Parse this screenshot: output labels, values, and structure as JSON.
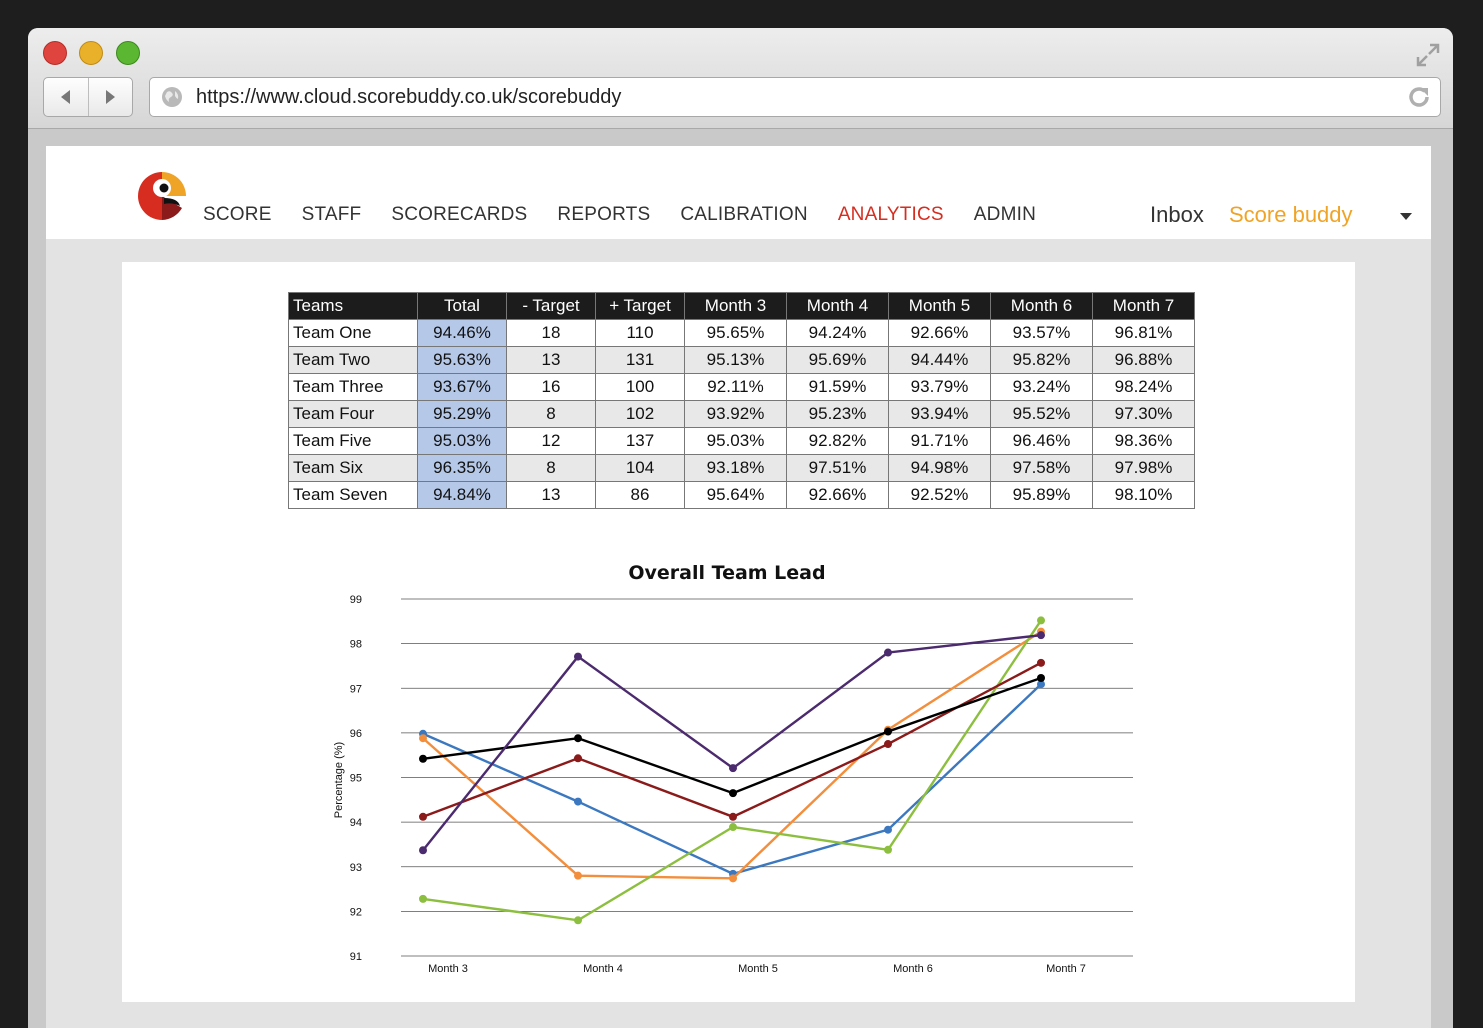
{
  "browser": {
    "url": "https://www.cloud.scorebuddy.co.uk/scorebuddy"
  },
  "nav": {
    "items": [
      {
        "label": "SCORE",
        "active": false
      },
      {
        "label": "STAFF",
        "active": false
      },
      {
        "label": "SCORECARDS",
        "active": false
      },
      {
        "label": "REPORTS",
        "active": false
      },
      {
        "label": "CALIBRATION",
        "active": false
      },
      {
        "label": "ANALYTICS",
        "active": true
      },
      {
        "label": "ADMIN",
        "active": false
      }
    ],
    "inbox": "Inbox",
    "user": "Score buddy",
    "active_color": "#d62d20",
    "user_color": "#f0a427"
  },
  "table": {
    "headers": [
      "Teams",
      "Total",
      "- Target",
      "+ Target",
      "Month 3",
      "Month 4",
      "Month 5",
      "Month 6",
      "Month 7"
    ],
    "rows": [
      [
        "Team One",
        "94.46%",
        "18",
        "110",
        "95.65%",
        "94.24%",
        "92.66%",
        "93.57%",
        "96.81%"
      ],
      [
        "Team Two",
        "95.63%",
        "13",
        "131",
        "95.13%",
        "95.69%",
        "94.44%",
        "95.82%",
        "96.88%"
      ],
      [
        "Team Three",
        "93.67%",
        "16",
        "100",
        "92.11%",
        "91.59%",
        "93.79%",
        "93.24%",
        "98.24%"
      ],
      [
        "Team Four",
        "95.29%",
        "8",
        "102",
        "93.92%",
        "95.23%",
        "93.94%",
        "95.52%",
        "97.30%"
      ],
      [
        "Team Five",
        "95.03%",
        "12",
        "137",
        "95.03%",
        "92.82%",
        "91.71%",
        "96.46%",
        "98.36%"
      ],
      [
        "Team Six",
        "96.35%",
        "8",
        "104",
        "93.18%",
        "97.51%",
        "94.98%",
        "97.58%",
        "97.98%"
      ],
      [
        "Team Seven",
        "94.84%",
        "13",
        "86",
        "95.64%",
        "92.66%",
        "92.52%",
        "95.89%",
        "98.10%"
      ]
    ],
    "total_highlight": "#b5c8e8"
  },
  "chart_data": {
    "type": "line",
    "title": "Overall Team Lead",
    "ylabel": "Percentage (%)",
    "xlabel": "",
    "categories": [
      "Month 3",
      "Month 4",
      "Month 5",
      "Month 6",
      "Month 7"
    ],
    "ylim": [
      91,
      99
    ],
    "yticks": [
      "91",
      "92",
      "93",
      "94",
      "95",
      "96",
      "97",
      "98",
      "99"
    ],
    "grid": true,
    "legend": "none",
    "series": [
      {
        "color": "#3b78c0",
        "values": [
          95.98,
          94.46,
          92.84,
          93.83,
          97.09
        ]
      },
      {
        "color": "#f28e3c",
        "values": [
          95.88,
          92.8,
          92.74,
          96.07,
          98.27
        ]
      },
      {
        "color": "#8cbf3f",
        "values": [
          92.28,
          91.8,
          93.89,
          93.38,
          98.52
        ]
      },
      {
        "color": "#8b1a1a",
        "values": [
          94.12,
          95.43,
          94.12,
          95.75,
          97.57
        ]
      },
      {
        "color": "#000000",
        "values": [
          95.42,
          95.88,
          94.65,
          96.03,
          97.23
        ]
      },
      {
        "color": "#4b2a6e",
        "values": [
          93.37,
          97.71,
          95.21,
          97.8,
          98.19
        ]
      }
    ]
  }
}
